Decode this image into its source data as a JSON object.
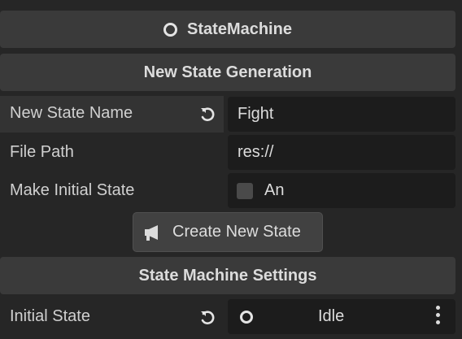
{
  "inspector": {
    "node_title": "StateMachine",
    "node_icon": "circle-icon"
  },
  "generation": {
    "section_title": "New State Generation",
    "new_state_name": {
      "label": "New State Name",
      "value": "Fight",
      "revert_icon": "revert-icon"
    },
    "file_path": {
      "label": "File Path",
      "value": "res://"
    },
    "make_initial": {
      "label": "Make Initial State",
      "checkbox_text": "An",
      "checked": false
    },
    "create_button": {
      "label": "Create New State",
      "icon": "megaphone-icon"
    }
  },
  "settings": {
    "section_title": "State Machine Settings",
    "initial_state": {
      "label": "Initial State",
      "value": "Idle",
      "revert_icon": "revert-icon",
      "node_icon": "circle-icon",
      "menu_icon": "kebab-menu-icon"
    }
  }
}
